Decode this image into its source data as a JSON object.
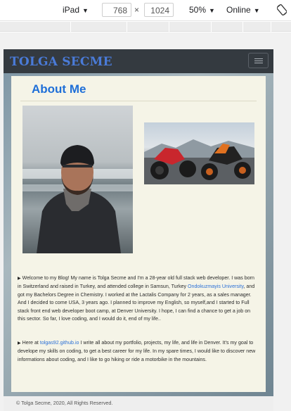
{
  "devtools": {
    "device": "iPad",
    "width": "768",
    "height": "1024",
    "times": "×",
    "zoom": "50%",
    "network": "Online",
    "caret": "▼"
  },
  "site": {
    "brand": "TOLGA SECME",
    "heading": "About Me",
    "p1": {
      "bullet": "▶",
      "before_link": "Welcome to my Blog! My name is Tolga Secme and I'm a 28-year old full stack web developer. I was born in Switzerland and raised in Turkey, and attended college in Samsun, Turkey ",
      "link": "Ondokuzmayis University",
      "after_link": ", and got my Bachelors Degree in Chemistry. I worked at the Lactalis Company for 2 years, as a sales manager. And I decided to come USA, 3 years ago. I planned to improve my English, so myself,and I started to Full stack front end web developer boot camp, at Denver University. I hope, I can find a chance to get a job on this sector. So far, I love coding, and I would do it, end of my life.."
    },
    "p2": {
      "bullet": "▶",
      "before_link": "Here at ",
      "link": "tolgas92.github.io",
      "after_link": " I write all about my portfolio, projects, my life, and life in Denver. It's my goal to develope my skills on coding, to get a best career for my life. In my spare times, I would like to discover new informations about coding, and I like to go hiking or ride a motorbike in the mountains."
    },
    "footer": "© Tolga Secme, 2020, All Rights Reserved."
  }
}
